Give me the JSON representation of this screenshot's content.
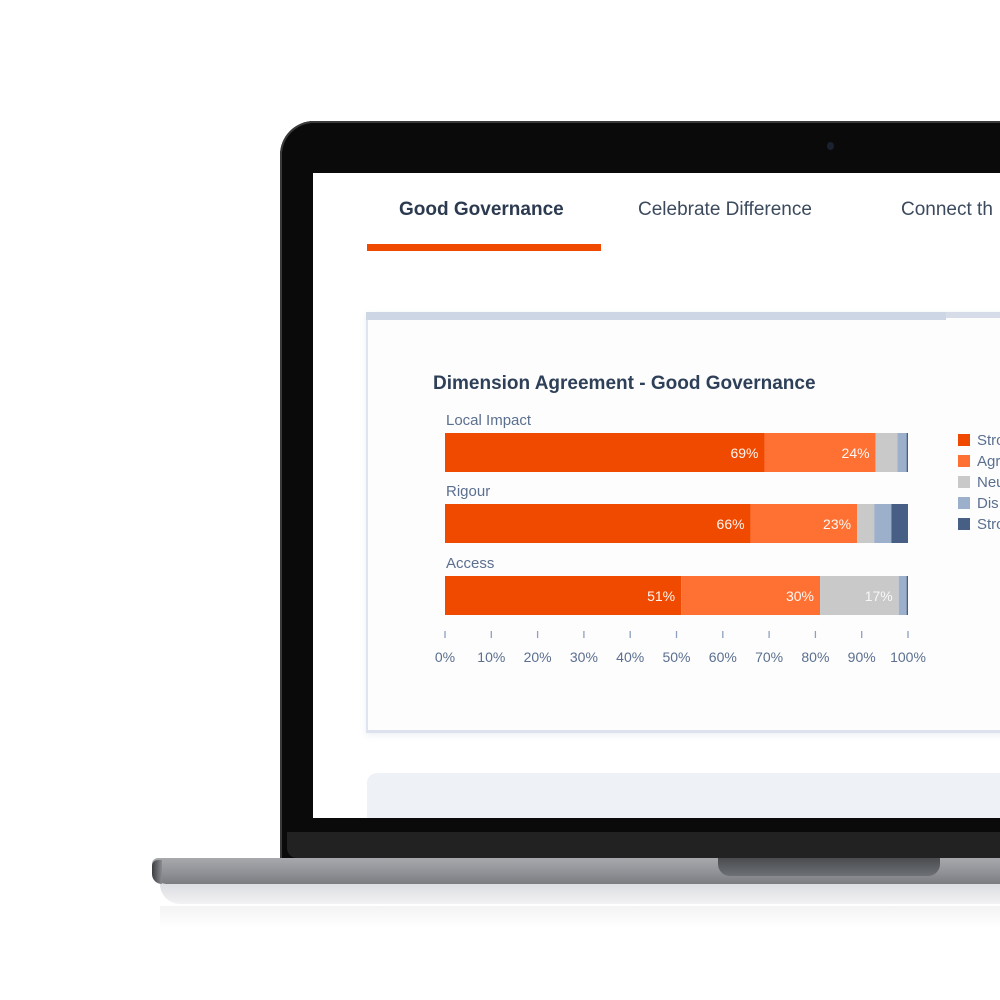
{
  "tabs": [
    {
      "label": "Good Governance",
      "active": true
    },
    {
      "label": "Celebrate Difference",
      "active": false
    },
    {
      "label": "Connect th",
      "active": false
    }
  ],
  "colors": {
    "accent": "#f04a00",
    "strongly_agree": "#f04a00",
    "agree": "#ff7033",
    "neutral": "#c9c9c9",
    "disagree": "#9cafcb",
    "strongly_disagree": "#475f84",
    "text_dark": "#2e3f58",
    "text_muted": "#5b6f8f"
  },
  "chart_data": {
    "type": "bar",
    "orientation": "horizontal",
    "stacked": true,
    "title": "Dimension Agreement - Good Governance",
    "categories": [
      "Local Impact",
      "Rigour",
      "Access"
    ],
    "series": [
      {
        "name": "Strongly Agree",
        "legend_visible_text": "Stro",
        "values": [
          69,
          66,
          51
        ],
        "labels": [
          "69%",
          "66%",
          "51%"
        ]
      },
      {
        "name": "Agree",
        "legend_visible_text": "Agr",
        "values": [
          24,
          23,
          30
        ],
        "labels": [
          "24%",
          "23%",
          "30%"
        ]
      },
      {
        "name": "Neutral",
        "legend_visible_text": "Neu",
        "values": [
          4.7,
          3.7,
          17
        ],
        "labels": [
          "",
          "",
          "17%"
        ]
      },
      {
        "name": "Disagree",
        "legend_visible_text": "Dis",
        "values": [
          2,
          3.7,
          1.7
        ],
        "labels": [
          "",
          "",
          ""
        ]
      },
      {
        "name": "Strongly Disagree",
        "legend_visible_text": "Stro",
        "values": [
          0.3,
          3.6,
          0.3
        ],
        "labels": [
          "",
          "",
          ""
        ]
      }
    ],
    "xlim": [
      0,
      100
    ],
    "xticks": [
      "0%",
      "10%",
      "20%",
      "30%",
      "40%",
      "50%",
      "60%",
      "70%",
      "80%",
      "90%",
      "100%"
    ],
    "xlabel": "",
    "ylabel": "",
    "grid": false,
    "legend_position": "right"
  }
}
